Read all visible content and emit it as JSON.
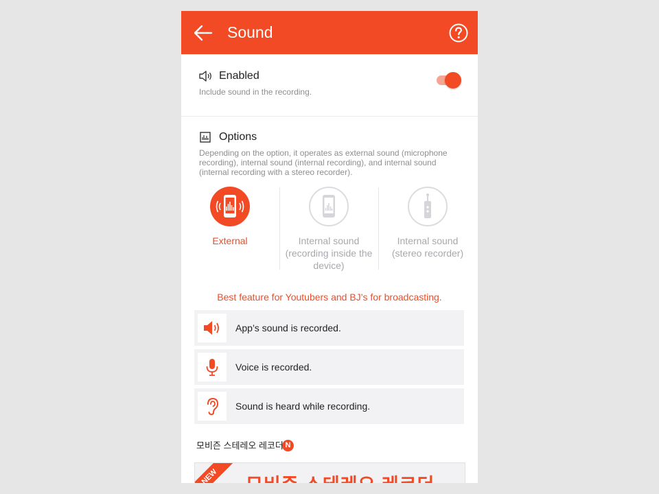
{
  "header": {
    "title": "Sound",
    "back_icon": "arrow-left-icon",
    "help_icon": "question-circle-icon"
  },
  "enabled": {
    "title": "Enabled",
    "description": "Include sound in the recording.",
    "toggle_on": true,
    "icon": "speaker-icon"
  },
  "options": {
    "title": "Options",
    "icon": "equalizer-image-icon",
    "description_lines": [
      "Depending on the option, it operates as external sound (microphone",
      "recording), internal sound (internal recording), and internal sound",
      "(internal recording with a stereo recorder)."
    ],
    "choices": [
      {
        "label_lines": [
          "External"
        ],
        "selected": true,
        "icon": "phone-sound-icon"
      },
      {
        "label_lines": [
          "Internal sound",
          "(recording inside the",
          "device)"
        ],
        "selected": false,
        "icon": "phone-internal-icon"
      },
      {
        "label_lines": [
          "Internal sound",
          "(stereo recorder)"
        ],
        "selected": false,
        "icon": "stereo-recorder-icon"
      }
    ]
  },
  "highlight": "Best feature for Youtubers and BJ’s for broadcasting.",
  "features": [
    {
      "text": "App’s sound is recorded.",
      "icon": "speaker-volume-icon"
    },
    {
      "text": "Voice is recorded.",
      "icon": "microphone-icon"
    },
    {
      "text": "Sound is heard while recording.",
      "icon": "ear-icon"
    }
  ],
  "promo": {
    "title": "모비즌 스테레오 레코더",
    "badge": "N",
    "ribbon": "NEW",
    "banner_text": "모비즌 스테레오 레코더"
  },
  "colors": {
    "accent": "#f24a25",
    "inactive": "#c9c9cf",
    "background": "#e6e6e6"
  }
}
